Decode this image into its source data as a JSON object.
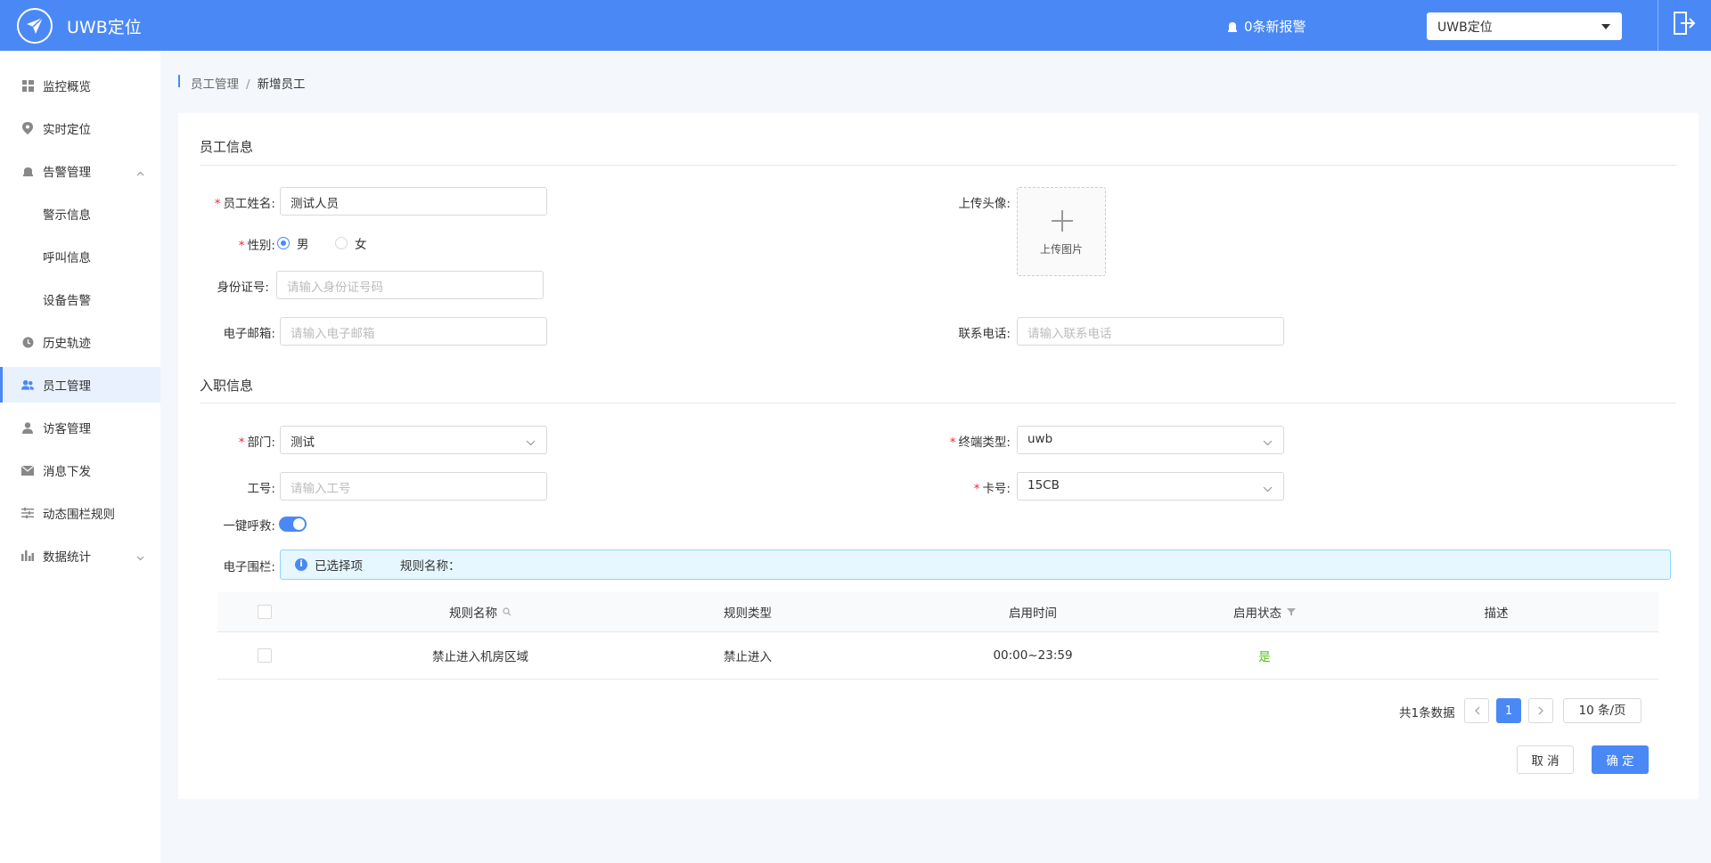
{
  "header": {
    "app_title": "UWB定位",
    "alarm_text": "0条新报警",
    "system_select": "UWB定位"
  },
  "sidebar": {
    "items": [
      {
        "label": "监控概览",
        "icon": "dashboard-icon"
      },
      {
        "label": "实时定位",
        "icon": "location-pin-icon"
      },
      {
        "label": "告警管理",
        "icon": "bell-icon"
      },
      {
        "label": "警示信息"
      },
      {
        "label": "呼叫信息"
      },
      {
        "label": "设备告警"
      },
      {
        "label": "历史轨迹",
        "icon": "clock-icon"
      },
      {
        "label": "员工管理",
        "icon": "users-icon"
      },
      {
        "label": "访客管理",
        "icon": "user-icon"
      },
      {
        "label": "消息下发",
        "icon": "mail-icon"
      },
      {
        "label": "动态围栏规则",
        "icon": "rules-list-icon"
      },
      {
        "label": "数据统计",
        "icon": "bar-chart-icon"
      }
    ],
    "active": "员工管理"
  },
  "breadcrumb": {
    "parent": "员工管理",
    "separator": "/",
    "current": "新增员工"
  },
  "form": {
    "section_employee": "员工信息",
    "name_label": "员工姓名:",
    "name_value": "测试人员",
    "gender_label": "性别:",
    "gender_male": "男",
    "gender_female": "女",
    "gender_selected": "男",
    "id_label": "身份证号:",
    "id_placeholder": "请输入身份证号码",
    "email_label": "电子邮箱:",
    "email_placeholder": "请输入电子邮箱",
    "avatar_label": "上传头像:",
    "avatar_text": "上传图片",
    "phone_label": "联系电话:",
    "phone_placeholder": "请输入联系电话",
    "section_job": "入职信息",
    "dept_label": "部门:",
    "dept_value": "测试",
    "terminal_label": "终端类型:",
    "terminal_value": "uwb",
    "work_no_label": "工号:",
    "work_no_placeholder": "请输入工号",
    "card_label": "卡号:",
    "card_value": "15CB",
    "sos_label": "一键呼救:",
    "sos_enabled": true,
    "fence_label": "电子围栏:",
    "fence_selected": "已选择项",
    "fence_rule_name": "规则名称："
  },
  "table": {
    "headers": [
      "规则名称",
      "规则类型",
      "启用时间",
      "启用状态",
      "描述"
    ],
    "rows": [
      {
        "name": "禁止进入机房区域",
        "type": "禁止进入",
        "time": "00:00~23:59",
        "status": "是",
        "desc": ""
      }
    ]
  },
  "pagination": {
    "total": "共1条数据",
    "current_page": "1",
    "page_size": "10 条/页"
  },
  "actions": {
    "cancel": "取 消",
    "confirm": "确 定"
  }
}
